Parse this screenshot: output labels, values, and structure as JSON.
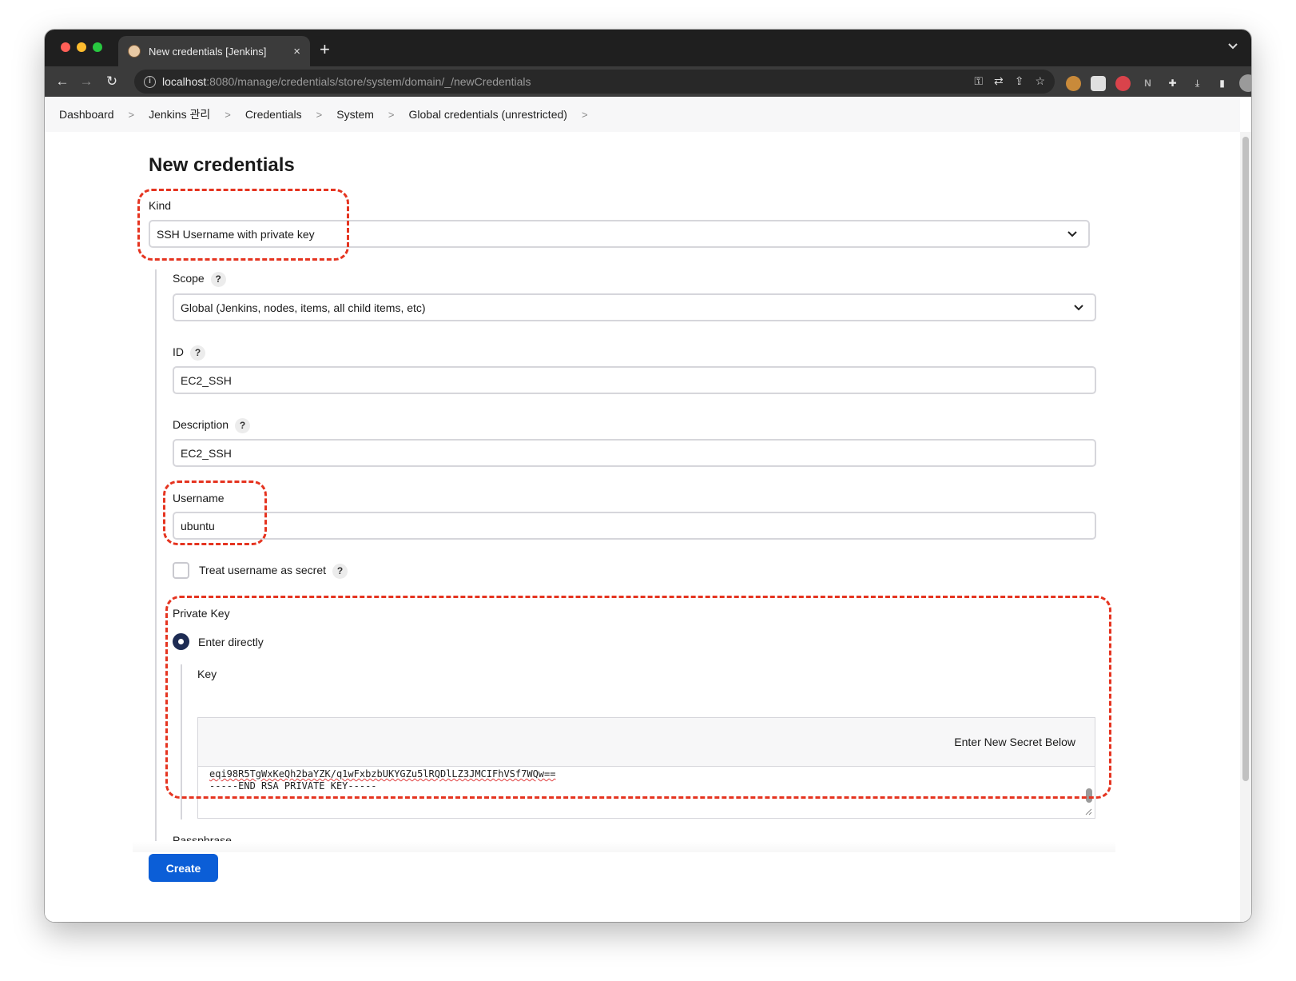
{
  "browser": {
    "tab_title": "New credentials [Jenkins]",
    "tab_close": "×",
    "new_tab": "+",
    "tabs_menu": "⌄",
    "url_host": "localhost",
    "url_rest": ":8080/manage/credentials/store/system/domain/_/newCredentials",
    "back": "←",
    "forward": "→",
    "reload": "↻"
  },
  "breadcrumb": [
    "Dashboard",
    "Jenkins 관리",
    "Credentials",
    "System",
    "Global credentials (unrestricted)"
  ],
  "page": {
    "title": "New credentials",
    "kind_label": "Kind",
    "kind_value": "SSH Username with private key",
    "scope_label": "Scope",
    "scope_value": "Global (Jenkins, nodes, items, all child items, etc)",
    "id_label": "ID",
    "id_value": "EC2_SSH",
    "description_label": "Description",
    "description_value": "EC2_SSH",
    "username_label": "Username",
    "username_value": "ubuntu",
    "treat_secret_label": "Treat username as secret",
    "private_key_label": "Private Key",
    "enter_directly_label": "Enter directly",
    "key_label": "Key",
    "enter_new_secret": "Enter New Secret Below",
    "key_line1": "eqi98R5TgWxKeQh2baYZK/q1wFxbzbUKYGZu5lRQDlLZ3JMCIFhVSf7WQw==",
    "key_line2": "-----END RSA PRIVATE KEY-----",
    "passphrase_label": "Passphrase",
    "create_button": "Create",
    "help": "?"
  },
  "colors": {
    "annotation": "#e53420",
    "primary_button": "#0b5ed7",
    "radio_selected": "#1d2b53"
  }
}
